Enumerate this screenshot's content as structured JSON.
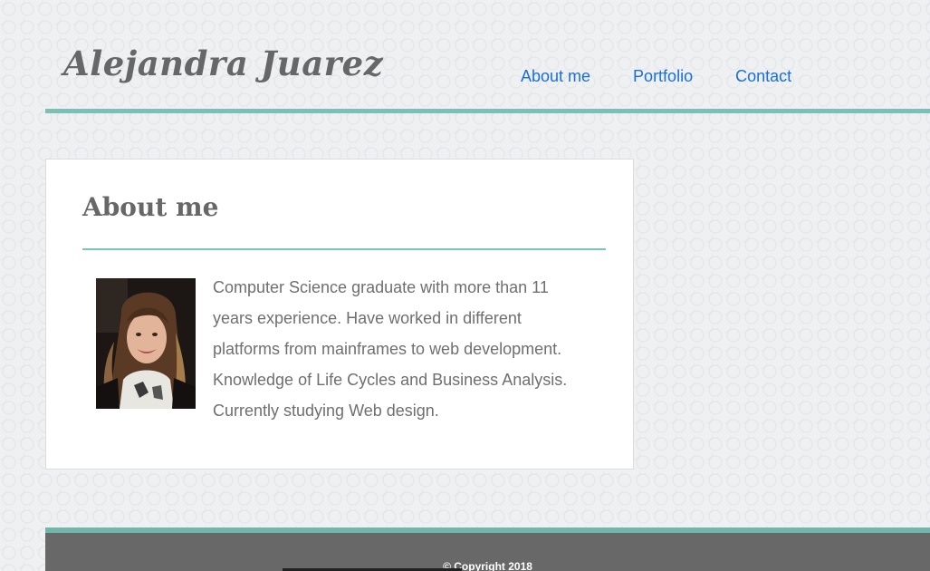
{
  "header": {
    "site_title": "Alejandra Juarez",
    "nav": [
      {
        "label": "About me"
      },
      {
        "label": "Portfolio"
      },
      {
        "label": "Contact"
      }
    ]
  },
  "about": {
    "heading": "About me",
    "bio": "Computer Science graduate with more than 11 years experience. Have worked in different platforms from mainframes to web development. Knowledge of Life Cycles and Business Analysis. Currently studying Web design.",
    "photo_icon": "portrait-photo"
  },
  "footer": {
    "copyright": "© Copyright 2018"
  },
  "colors": {
    "accent": "#7cbfb5",
    "nav_link": "#1a6fd6",
    "title_text": "#676767",
    "body_text": "#6f6f6f",
    "footer_bg": "#686868"
  }
}
